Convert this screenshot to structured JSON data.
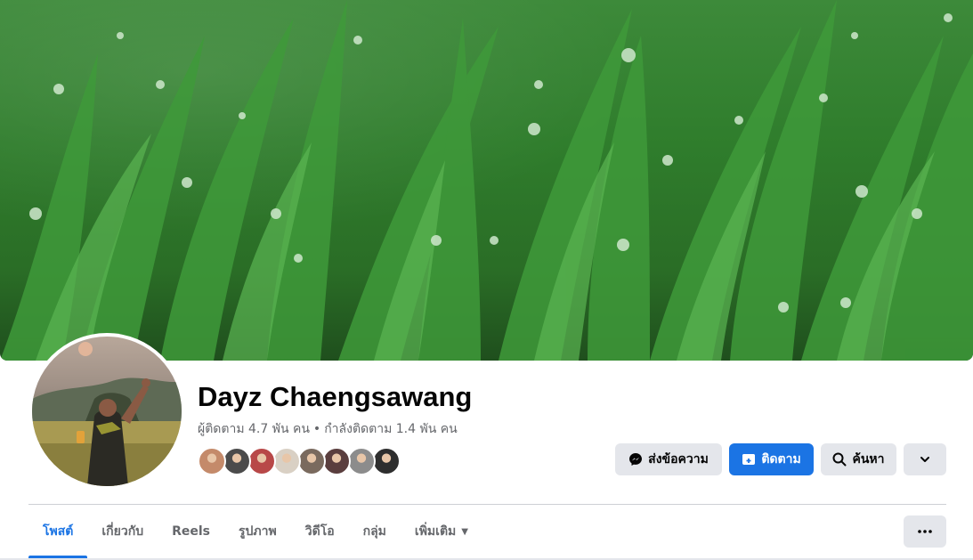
{
  "profile": {
    "name": "Dayz Chaengsawang",
    "followers_text": "ผู้ติดตาม 4.7 พัน คน",
    "separator": "•",
    "following_text": "กำลังติดตาม 1.4 พัน คน"
  },
  "friend_avatars": [
    {
      "color": "#c48a6a"
    },
    {
      "color": "#4b4b4b"
    },
    {
      "color": "#b84848"
    },
    {
      "color": "#d9d0c4"
    },
    {
      "color": "#7a6a5e"
    },
    {
      "color": "#5a3e3e"
    },
    {
      "color": "#8c8c8c"
    },
    {
      "color": "#2e2e2e"
    }
  ],
  "actions": {
    "message_label": "ส่งข้อความ",
    "follow_label": "ติดตาม",
    "search_label": "ค้นหา"
  },
  "tabs": [
    {
      "label": "โพสต์",
      "active": true
    },
    {
      "label": "เกี่ยวกับ",
      "active": false
    },
    {
      "label": "Reels",
      "active": false
    },
    {
      "label": "รูปภาพ",
      "active": false
    },
    {
      "label": "วิดีโอ",
      "active": false
    },
    {
      "label": "กลุ่ม",
      "active": false
    },
    {
      "label": "เพิ่มเติม",
      "active": false
    }
  ],
  "colors": {
    "primary": "#1b74e4",
    "secondary_button": "#e4e6eb",
    "muted_text": "#65676b"
  },
  "icons": {
    "message": "messenger-icon",
    "follow": "follow-icon",
    "search": "search-icon",
    "dropdown": "chevron-down-icon",
    "more": "more-dots-icon"
  }
}
